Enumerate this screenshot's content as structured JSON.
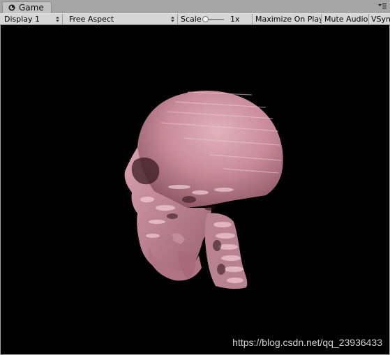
{
  "tab": {
    "title": "Game",
    "icon": "unity-logo-icon"
  },
  "window_menu_icon": "window-menu-icon",
  "toolbar": {
    "display": "Display 1",
    "aspect": "Free Aspect",
    "scale_label": "Scale",
    "scale_value": "1x",
    "maximize": "Maximize On Play",
    "mute": "Mute Audio",
    "vsync": "VSync"
  },
  "viewport": {
    "subject": "skull-render",
    "watermark": "https://blog.csdn.net/qq_23936433"
  }
}
